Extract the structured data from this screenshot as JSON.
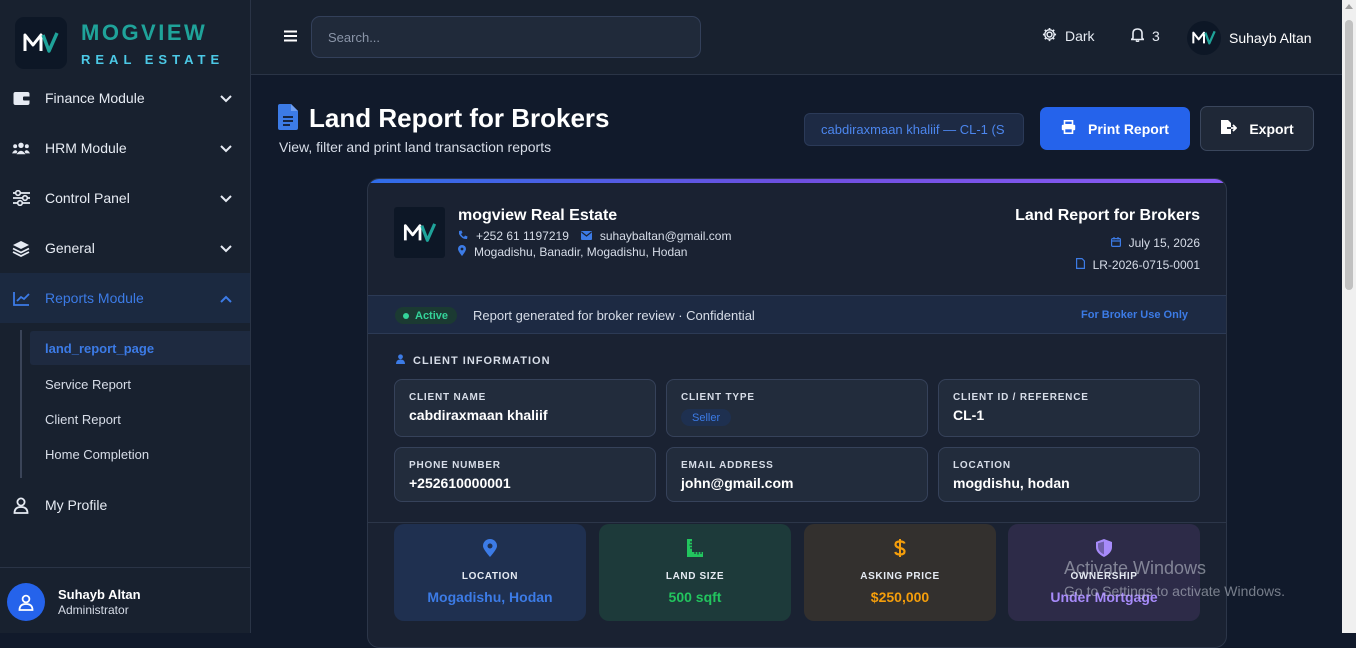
{
  "brand": {
    "title": "MOGVIEW",
    "subtitle": "REAL ESTATE"
  },
  "sidebar": {
    "items": [
      {
        "label": "Finance Module"
      },
      {
        "label": "HRM Module"
      },
      {
        "label": "Control Panel"
      },
      {
        "label": "General"
      },
      {
        "label": "Reports Module"
      }
    ],
    "subitems": [
      {
        "label": "land_report_page"
      },
      {
        "label": "Service Report"
      },
      {
        "label": "Client Report"
      },
      {
        "label": "Home Completion"
      }
    ],
    "profile_label": "My Profile",
    "user": {
      "name": "Suhayb Altan",
      "role": "Administrator"
    }
  },
  "topbar": {
    "search_placeholder": "Search...",
    "theme_label": "Dark",
    "notification_count": "3",
    "user_name": "Suhayb Altan"
  },
  "page": {
    "title": "Land Report for Brokers",
    "subtitle": "View, filter and print land transaction reports",
    "client_select": "cabdiraxmaan khaliif — CL-1 (S",
    "print_label": "Print Report",
    "export_label": "Export"
  },
  "report": {
    "company_name": "mogview Real Estate",
    "phone": "+252 61 1197219",
    "email": "suhaybaltan@gmail.com",
    "address": "Mogadishu, Banadir, Mogadishu, Hodan",
    "title": "Land Report for Brokers",
    "date": "July 15, 2026",
    "report_id": "LR-2026-0715-0001",
    "status": "Active",
    "status_text": "Report generated for broker review · Confidential",
    "broker_note": "For Broker Use Only",
    "section_client": "CLIENT INFORMATION",
    "fields": [
      {
        "label": "CLIENT NAME",
        "value": "cabdiraxmaan khaliif"
      },
      {
        "label": "CLIENT TYPE",
        "value": "Seller"
      },
      {
        "label": "CLIENT ID / REFERENCE",
        "value": "CL-1"
      },
      {
        "label": "PHONE NUMBER",
        "value": "+252610000001"
      },
      {
        "label": "EMAIL ADDRESS",
        "value": "john@gmail.com"
      },
      {
        "label": "LOCATION",
        "value": "mogdishu, hodan"
      }
    ],
    "stats": [
      {
        "label": "LOCATION",
        "value": "Mogadishu, Hodan",
        "color": "#3c7be6"
      },
      {
        "label": "LAND SIZE",
        "value": "500 sqft",
        "color": "#22c55e"
      },
      {
        "label": "ASKING PRICE",
        "value": "$250,000",
        "color": "#f59e0b"
      },
      {
        "label": "OWNERSHIP",
        "value": "Under Mortgage",
        "color": "#a78bfa"
      }
    ]
  },
  "watermark": {
    "line1": "Activate Windows",
    "line2": "Go to Settings to activate Windows."
  }
}
